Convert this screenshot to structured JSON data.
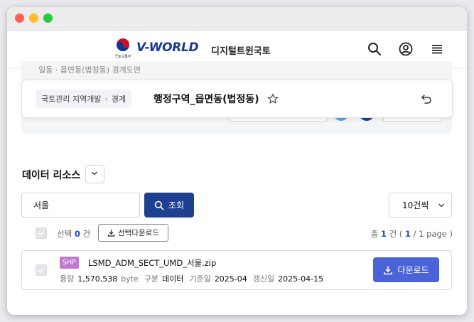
{
  "header": {
    "ministry_text": "국토교통부",
    "brand": "V-WORLD",
    "brand_sub": "디지털트윈국토"
  },
  "panel": {
    "peek_text": "일동 · 읍면동(법정동) 경계도면"
  },
  "card": {
    "breadcrumb": [
      "국토관리 지역개발",
      "경계"
    ],
    "title": "행정구역_읍면동(법정동)"
  },
  "list": {
    "title": "데이터 리소스",
    "search_value": "서울",
    "search_label": "조회",
    "per_page": "10건씩",
    "selected_prefix": "선택",
    "selected_count": "0",
    "selected_suffix": "건",
    "selected_download_label": "선택다운로드",
    "total_prefix": "총",
    "total_count": "1",
    "total_mid": "건 (",
    "page_current": "1",
    "page_sep": "/",
    "page_total": "1 page )"
  },
  "file": {
    "type_badge": "SHP",
    "name": "LSMD_ADM_SECT_UMD_서울.zip",
    "size_label": "용량",
    "size_value": "1,570,538",
    "size_unit": "byte",
    "category_label": "구분",
    "category_value": "데이터",
    "base_date_label": "기준일",
    "base_date_value": "2025-04",
    "updated_label": "갱신일",
    "updated_value": "2025-04-15",
    "download_label": "다운로드"
  },
  "pagination": {
    "current": "1"
  },
  "colors": {
    "primary_navy": "#1f3f91",
    "download_blue": "#4a63d8",
    "badge_purple": "#c079cc",
    "accent_blue": "#1f4fbf"
  },
  "icons": [
    "search-icon",
    "user-icon",
    "menu-icon",
    "star-icon",
    "undo-icon",
    "chevron-down-icon",
    "download-icon",
    "check-icon"
  ]
}
